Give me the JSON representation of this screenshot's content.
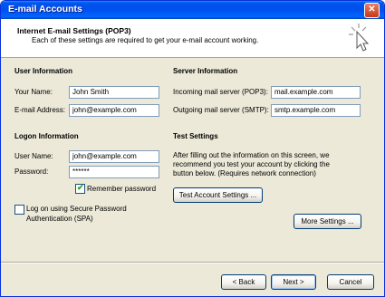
{
  "window": {
    "title": "E-mail Accounts",
    "close_glyph": "✕"
  },
  "header": {
    "title": "Internet E-mail Settings (POP3)",
    "subtitle": "Each of these settings are required to get your e-mail account working."
  },
  "user_info": {
    "heading": "User Information",
    "name_label": "Your Name:",
    "name_value": "John Smith",
    "email_label": "E-mail Address:",
    "email_value": "john@example.com"
  },
  "logon_info": {
    "heading": "Logon Information",
    "username_label": "User Name:",
    "username_value": "john@example.com",
    "password_label": "Password:",
    "password_value": "******",
    "remember_label": "Remember password",
    "remember_checked": true,
    "spa_label_line1": "Log on using Secure Password",
    "spa_label_line2": "Authentication (SPA)",
    "spa_checked": false
  },
  "server_info": {
    "heading": "Server Information",
    "incoming_label": "Incoming mail server (POP3):",
    "incoming_value": "mail.example.com",
    "outgoing_label": "Outgoing mail server (SMTP):",
    "outgoing_value": "smtp.example.com"
  },
  "test_settings": {
    "heading": "Test Settings",
    "description_line1": "After filling out the information on this screen, we",
    "description_line2": "recommend you test your account by clicking the",
    "description_line3": "button below. (Requires network connection)",
    "test_button": "Test Account Settings ..."
  },
  "more_settings_button": "More Settings ...",
  "footer": {
    "back": "< Back",
    "next": "Next >",
    "cancel": "Cancel"
  },
  "colors": {
    "titlebar": "#0054e3",
    "dialog_bg": "#ece9d8",
    "button_border": "#003c74"
  }
}
